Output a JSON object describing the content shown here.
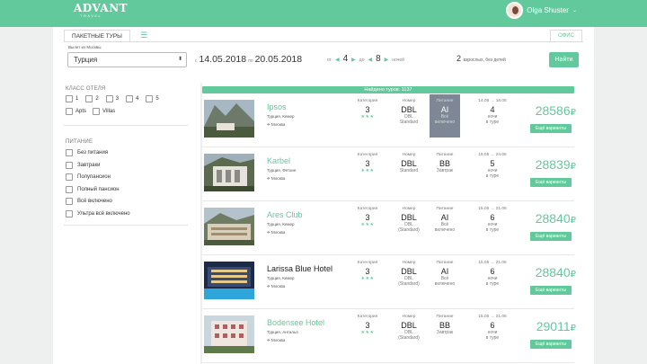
{
  "header": {
    "logo": "ADVANT",
    "logo_sub": "TRAVEL",
    "user_name": "Olga Shuster",
    "user_caret": "⌄"
  },
  "search": {
    "tab_active": "ПАКЕТНЫЕ ТУРЫ",
    "tab_menu": "☰",
    "tab_office": "ОФИС",
    "depart_label": "Вылет из Москвы",
    "country": "Турция",
    "date_from_prefix": "с",
    "date_from": "14.05.2018",
    "date_to_prefix": "по",
    "date_to": "20.05.2018",
    "nights_from_prefix": "от",
    "nights_from": "4",
    "nights_to_prefix": "до",
    "nights_to": "8",
    "nights_suffix": "ночей",
    "tourists_count": "2",
    "tourists_text": "взрослых, без детей",
    "find_button": "Найти"
  },
  "filters": {
    "hotel_class_title": "КЛАСС ОТЕЛЯ",
    "stars": [
      "1",
      "2",
      "3",
      "4",
      "5"
    ],
    "types": [
      "Apts",
      "Villas"
    ],
    "food_title": "ПИТАНИЕ",
    "food_options": [
      "Без питания",
      "Завтраки",
      "Полупансион",
      "Полный пансион",
      "Всё включено",
      "Ультра всё включено"
    ]
  },
  "results": {
    "found_text": "Найдено туров: 1137",
    "col_category": "Категория",
    "col_room": "Номер",
    "col_food": "Питание",
    "more_button": "Ещё варианты",
    "currency": "₽",
    "nights_label_1": "ночи",
    "nights_label_2": "в туре",
    "hotels": [
      {
        "name": "Ipsos",
        "location": "Турция, Кемер",
        "city": "✈ Москва",
        "category": "3",
        "stars": "★★★",
        "room": "DBL",
        "room_sub1": "DBL",
        "room_sub2": "Standard",
        "food": "AI",
        "food_sub1": "Всё",
        "food_sub2": "включено",
        "dates": "14.05 → 18.05",
        "nights": "4",
        "price": "28586",
        "highlight": true
      },
      {
        "name": "Karbel",
        "location": "Турция, Фетхие",
        "city": "✈ Москва",
        "category": "3",
        "stars": "★★★",
        "room": "DBL",
        "room_sub1": "Standard",
        "room_sub2": "",
        "food": "BB",
        "food_sub1": "Завтрак",
        "food_sub2": "",
        "dates": "19.05 → 24.05",
        "nights": "5",
        "price": "28839",
        "highlight": false
      },
      {
        "name": "Ares Club",
        "location": "Турция, Кемер",
        "city": "✈ Москва",
        "category": "3",
        "stars": "★★★",
        "room": "DBL",
        "room_sub1": "DBL",
        "room_sub2": "(Standard)",
        "food": "AI",
        "food_sub1": "Всё",
        "food_sub2": "включено",
        "dates": "15.05 → 21.05",
        "nights": "6",
        "price": "28840",
        "highlight": false
      },
      {
        "name": "Larissa Blue Hotel",
        "location": "Турция, Кемер",
        "city": "✈ Москва",
        "category": "3",
        "stars": "★★★",
        "room": "DBL",
        "room_sub1": "DBL",
        "room_sub2": "(Standard)",
        "food": "AI",
        "food_sub1": "Всё",
        "food_sub2": "включено",
        "dates": "15.05 → 21.05",
        "nights": "6",
        "price": "28840",
        "highlight": false
      },
      {
        "name": "Bodensee Hotel",
        "location": "Турция, Анталья",
        "city": "✈ Москва",
        "category": "3",
        "stars": "★★★",
        "room": "DBL",
        "room_sub1": "DBL",
        "room_sub2": "(Standard)",
        "food": "BB",
        "food_sub1": "Завтрак",
        "food_sub2": "",
        "dates": "15.05 → 21.05",
        "nights": "6",
        "price": "29011",
        "highlight": false
      }
    ]
  },
  "colors": {
    "accent": "#62c99c",
    "highlight": "#7d8796"
  }
}
